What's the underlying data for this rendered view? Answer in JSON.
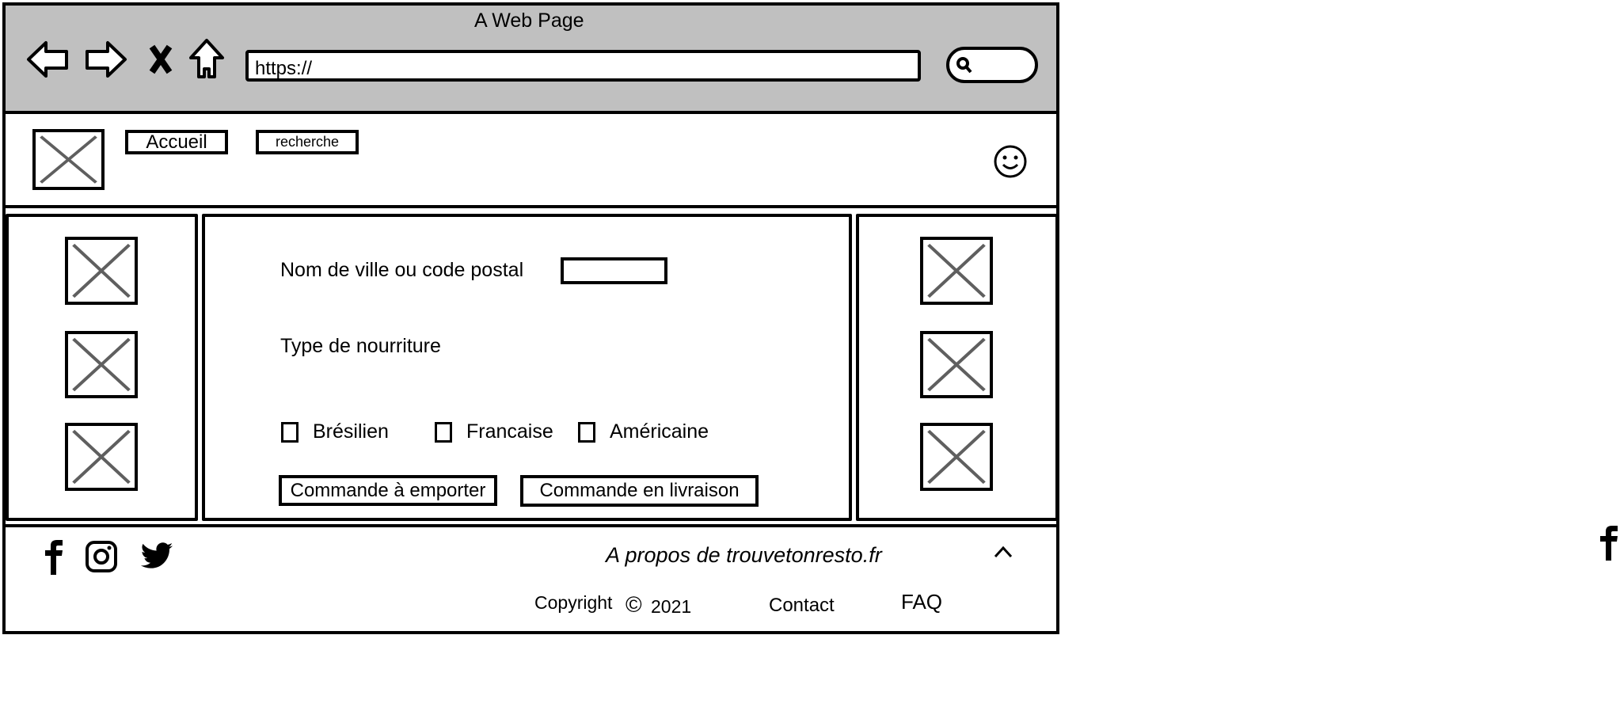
{
  "browser": {
    "title": "A Web Page",
    "url": "https://",
    "icons": [
      "back-arrow-icon",
      "forward-arrow-icon",
      "close-icon",
      "home-icon",
      "search-icon"
    ]
  },
  "header": {
    "nav": [
      {
        "label": "Accueil"
      },
      {
        "label": "recherche"
      }
    ],
    "user_icon": "smiley-icon"
  },
  "main": {
    "city_label": "Nom de ville ou code postal",
    "city_value": "",
    "food_type_label": "Type de nourriture",
    "food_types": [
      {
        "label": "Brésilien",
        "checked": false
      },
      {
        "label": "Francaise",
        "checked": false
      },
      {
        "label": "Américaine",
        "checked": false
      }
    ],
    "buttons": [
      {
        "label": "Commande à emporter"
      },
      {
        "label": "Commande en livraison"
      }
    ]
  },
  "footer": {
    "social": [
      "facebook-icon",
      "instagram-icon",
      "twitter-icon"
    ],
    "about": "A propos de trouvetonresto.fr",
    "copyright": "Copyright",
    "copyright_symbol": "©",
    "year": "2021",
    "contact": "Contact",
    "faq": "FAQ"
  },
  "colors": {
    "titlebar": "#c0c0c0",
    "placeholder_x": "#5f5f5f"
  }
}
